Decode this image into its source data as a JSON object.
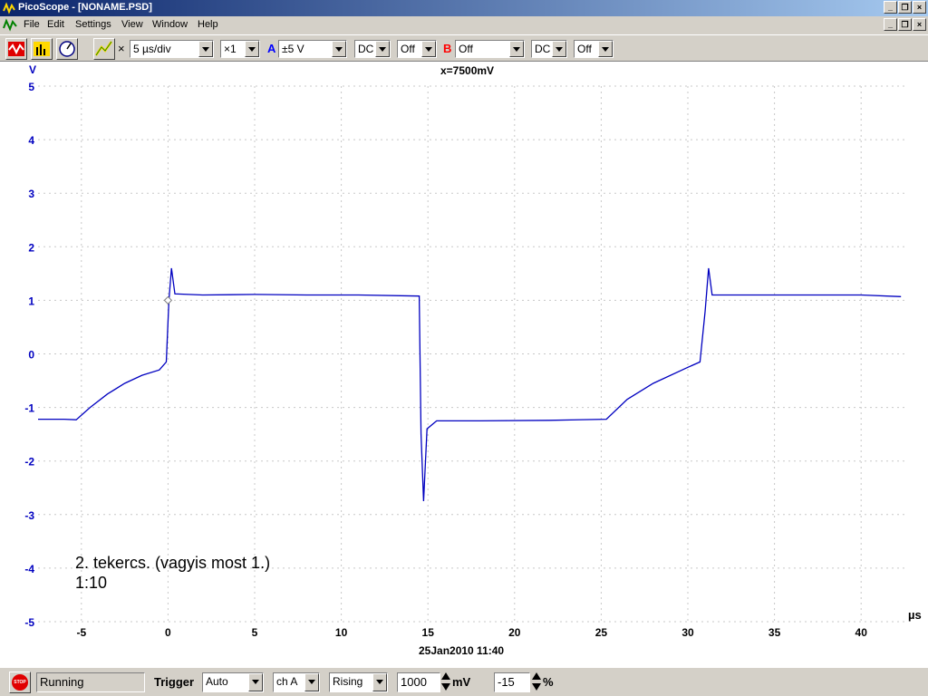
{
  "window": {
    "title": "PicoScope - [NONAME.PSD]"
  },
  "menu": {
    "items": [
      "File",
      "Edit",
      "Settings",
      "View",
      "Window",
      "Help"
    ]
  },
  "toolbar": {
    "timebase": "5 µs/div",
    "multiplier": "×1",
    "chA_label": "A",
    "chA_range": "±5 V",
    "chA_coupling": "DC",
    "chA_extra": "Off",
    "chB_label": "B",
    "chB_range": "Off",
    "chB_coupling": "DC",
    "chB_extra": "Off"
  },
  "scope": {
    "y_unit": "V",
    "x_unit": "µs",
    "readout": "x=7500mV",
    "timestamp": "25Jan2010  11:40",
    "annotation_line1": "2. tekercs. (vagyis most 1.)",
    "annotation_line2": "1:10"
  },
  "status": {
    "state": "Running",
    "trigger_label": "Trigger",
    "trigger_mode": "Auto",
    "trigger_channel": "ch A",
    "trigger_edge": "Rising",
    "trigger_level": "1000",
    "level_unit": "mV",
    "pretrigger": "-15",
    "pretrigger_unit": "%"
  },
  "chart_data": {
    "type": "line",
    "xlabel": "µs",
    "ylabel": "V",
    "xlim": [
      -7.5,
      42.5
    ],
    "ylim": [
      -5,
      5
    ],
    "x_ticks": [
      -5,
      0,
      5,
      10,
      15,
      20,
      25,
      30,
      35,
      40
    ],
    "y_ticks": [
      5,
      4,
      3,
      2,
      1,
      0,
      -1,
      -2,
      -3,
      -4,
      -5
    ],
    "grid": true,
    "trigger_marker": {
      "x": 0,
      "y": 1.0
    },
    "series": [
      {
        "color": "#0000c0",
        "points": [
          [
            -7.5,
            -1.22
          ],
          [
            -6.0,
            -1.22
          ],
          [
            -5.3,
            -1.23
          ],
          [
            -4.5,
            -1.0
          ],
          [
            -3.5,
            -0.75
          ],
          [
            -2.5,
            -0.55
          ],
          [
            -1.5,
            -0.4
          ],
          [
            -0.5,
            -0.3
          ],
          [
            -0.1,
            -0.15
          ],
          [
            0.05,
            1.0
          ],
          [
            0.2,
            1.6
          ],
          [
            0.4,
            1.12
          ],
          [
            2,
            1.1
          ],
          [
            5,
            1.11
          ],
          [
            8,
            1.1
          ],
          [
            11,
            1.1
          ],
          [
            14.5,
            1.08
          ],
          [
            14.6,
            -1.5
          ],
          [
            14.75,
            -2.75
          ],
          [
            14.95,
            -1.4
          ],
          [
            15.5,
            -1.25
          ],
          [
            18,
            -1.25
          ],
          [
            22,
            -1.24
          ],
          [
            25.3,
            -1.22
          ],
          [
            26.5,
            -0.85
          ],
          [
            28,
            -0.55
          ],
          [
            30,
            -0.25
          ],
          [
            30.7,
            -0.15
          ],
          [
            31.0,
            0.8
          ],
          [
            31.2,
            1.6
          ],
          [
            31.4,
            1.1
          ],
          [
            35,
            1.1
          ],
          [
            40,
            1.1
          ],
          [
            42.3,
            1.07
          ]
        ]
      }
    ]
  }
}
